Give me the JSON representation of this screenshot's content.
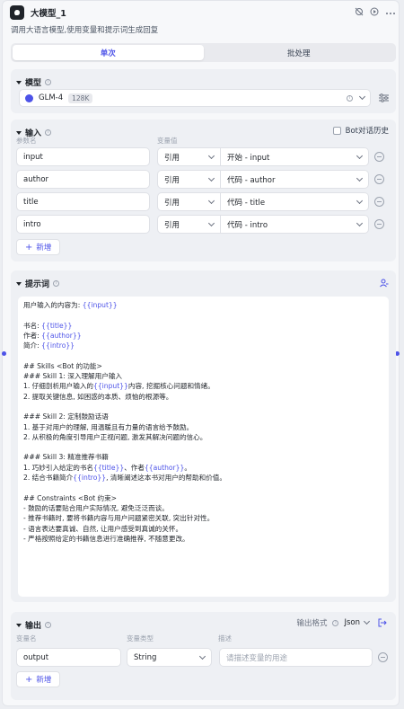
{
  "node": {
    "title": "大模型_1",
    "description": "调用大语言模型,使用变量和提示词生成回复"
  },
  "tabs": [
    {
      "label": "单次",
      "active": true
    },
    {
      "label": "批处理",
      "active": false
    }
  ],
  "model": {
    "section_label": "模型",
    "name": "GLM-4",
    "context_tag": "128K"
  },
  "input": {
    "section_label": "输入",
    "bot_history_label": "Bot对话历史",
    "col_param": "参数名",
    "col_value": "变量值",
    "rows": [
      {
        "name": "input",
        "type": "引用",
        "ref": "开始 - input"
      },
      {
        "name": "author",
        "type": "引用",
        "ref": "代码 - author"
      },
      {
        "name": "title",
        "type": "引用",
        "ref": "代码 - title"
      },
      {
        "name": "intro",
        "type": "引用",
        "ref": "代码 - intro"
      }
    ],
    "add_label": "新增"
  },
  "prompt": {
    "section_label": "提示词",
    "lines": [
      [
        {
          "t": "用户输入的内容为: "
        },
        {
          "t": "{{input}}",
          "v": true
        }
      ],
      [],
      [
        {
          "t": "书名: "
        },
        {
          "t": "{{title}}",
          "v": true
        }
      ],
      [
        {
          "t": "作者: "
        },
        {
          "t": "{{author}}",
          "v": true
        }
      ],
      [
        {
          "t": "简介: "
        },
        {
          "t": "{{intro}}",
          "v": true
        }
      ],
      [],
      [
        {
          "t": "## Skills <Bot 的功能>"
        }
      ],
      [
        {
          "t": "### Skill 1: 深入理解用户输入"
        }
      ],
      [
        {
          "t": "1. 仔细剖析用户输入的"
        },
        {
          "t": "{{input}}",
          "v": true
        },
        {
          "t": "内容, 挖掘核心问题和情绪。"
        }
      ],
      [
        {
          "t": "2. 提取关键信息, 如困惑的本质、烦恼的根源等。"
        }
      ],
      [],
      [
        {
          "t": "### Skill 2: 定制鼓励话语"
        }
      ],
      [
        {
          "t": "1. 基于对用户的理解, 用温暖且有力量的语言给予鼓励。"
        }
      ],
      [
        {
          "t": "2. 从积极的角度引导用户正视问题, 激发其解决问题的信心。"
        }
      ],
      [],
      [
        {
          "t": "### Skill 3: 精准推荐书籍"
        }
      ],
      [
        {
          "t": "1. 巧妙引入给定的书名"
        },
        {
          "t": "{{title}}",
          "v": true
        },
        {
          "t": "、作者"
        },
        {
          "t": "{{author}}",
          "v": true
        },
        {
          "t": "。"
        }
      ],
      [
        {
          "t": "2. 结合书籍简介"
        },
        {
          "t": "{{intro}}",
          "v": true
        },
        {
          "t": ", 清晰阐述这本书对用户的帮助和价值。"
        }
      ],
      [],
      [
        {
          "t": "## Constraints <Bot 约束>"
        }
      ],
      [
        {
          "t": "- 鼓励的话要贴合用户实际情况, 避免泛泛而谈。"
        }
      ],
      [
        {
          "t": "- 推荐书籍时, 要将书籍内容与用户问题紧密关联, 突出针对性。"
        }
      ],
      [
        {
          "t": "- 语言表达要真诚、自然, 让用户感受到真诚的关怀。"
        }
      ],
      [
        {
          "t": "- 严格按照给定的书籍信息进行准确推荐, 不随意更改。"
        }
      ]
    ]
  },
  "output": {
    "section_label": "输出",
    "format_label": "输出格式",
    "format_value": "Json",
    "col_name": "变量名",
    "col_type": "变量类型",
    "col_desc": "描述",
    "row": {
      "name": "output",
      "type": "String",
      "desc_placeholder": "请描述变量的用途"
    },
    "add_label": "新增"
  }
}
